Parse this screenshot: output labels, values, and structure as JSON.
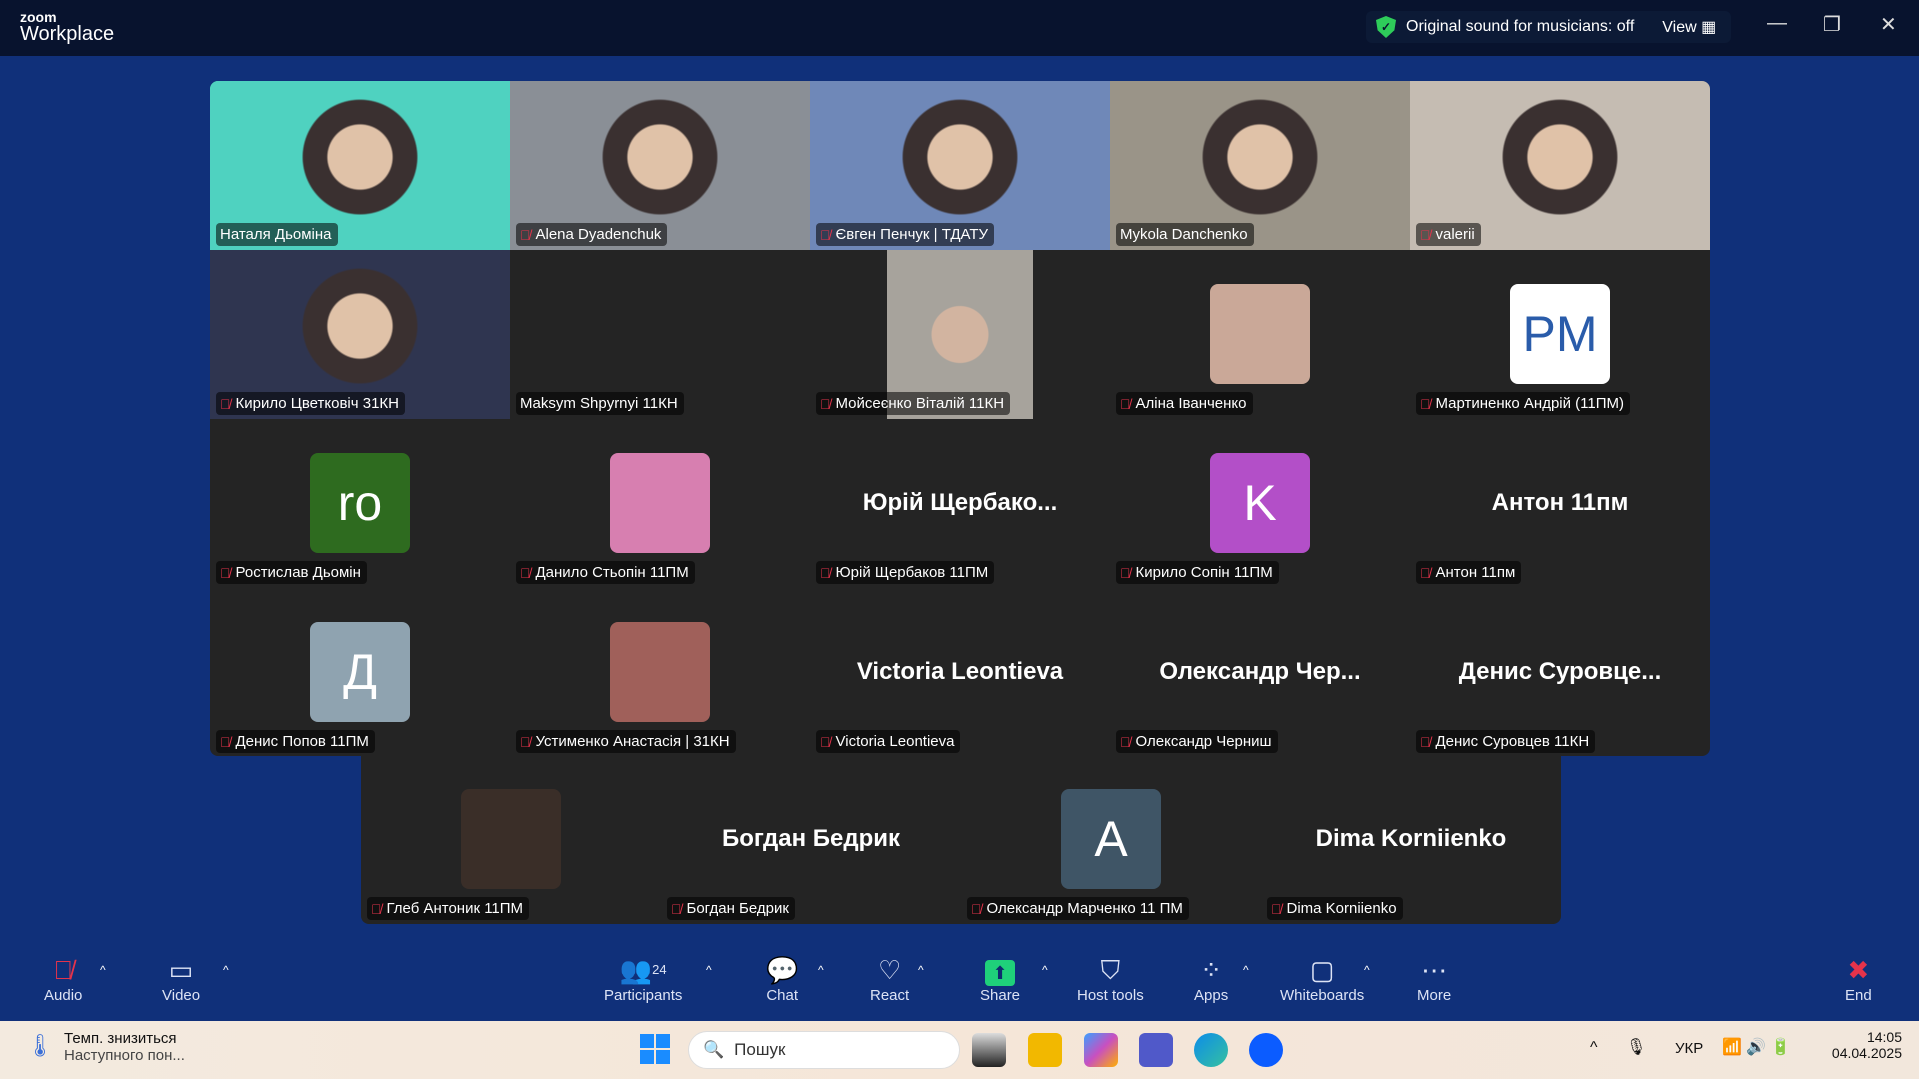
{
  "app": {
    "brand_small": "zoom",
    "brand_large": "Workplace"
  },
  "topbar": {
    "sound_status": "Original sound for musicians: off",
    "view_label": "View"
  },
  "tiles": [
    {
      "name": "Наталя Дьоміна",
      "type": "video",
      "bg": "#4fd2c0",
      "muted": false,
      "active": true
    },
    {
      "name": "Alena Dyadenchuk",
      "type": "video",
      "bg": "#8a8f96",
      "muted": true
    },
    {
      "name": "Євген Пенчук | ТДАТУ",
      "type": "video",
      "bg": "#6f88b8",
      "muted": true
    },
    {
      "name": "Mykola Danchenko",
      "type": "video",
      "bg": "#9a9488",
      "muted": false
    },
    {
      "name": "valerii",
      "type": "video",
      "bg": "#c5bcb2",
      "muted": true
    },
    {
      "name": "Кирило Цветковіч 31КН",
      "type": "video",
      "bg": "#2f3550",
      "muted": true
    },
    {
      "name": "Maksym Shpyrnyi 11КН",
      "type": "blank",
      "muted": false
    },
    {
      "name": "Мойсеєнко Віталій 11КН",
      "type": "portrait",
      "bg": "#a7a39c",
      "muted": true
    },
    {
      "name": "Аліна Іванченко",
      "type": "avatar",
      "bg": "#caa898",
      "initial": "",
      "muted": true
    },
    {
      "name": "Мартиненко Андрій (11ПМ)",
      "type": "avatar",
      "bg": "#ffffff",
      "initial": "PM",
      "fg": "#2a5caa",
      "muted": true
    },
    {
      "name": "Ростислав Дьомін",
      "type": "avatar",
      "bg": "#2e6b1f",
      "initial": "ro",
      "muted": true
    },
    {
      "name": "Данило Стьопін 11ПМ",
      "type": "avatar",
      "bg": "#d77fb0",
      "initial": "",
      "muted": true
    },
    {
      "name": "Юрій Щербаков 11ПМ",
      "type": "text",
      "big": "Юрій  Щербако...",
      "muted": true
    },
    {
      "name": "Кирило Сопін 11ПМ",
      "type": "avatar",
      "bg": "#b34fc8",
      "initial": "K",
      "muted": true
    },
    {
      "name": "Антон 11пм",
      "type": "text",
      "big": "Антон 11пм",
      "muted": true
    },
    {
      "name": "Денис Попов 11ПМ",
      "type": "avatar",
      "bg": "#8fa3b0",
      "initial": "Д",
      "muted": true
    },
    {
      "name": "Устименко Анастасія | 31КН",
      "type": "avatar",
      "bg": "#a0605a",
      "initial": "",
      "muted": true
    },
    {
      "name": "Victoria Leontieva",
      "type": "text",
      "big": "Victoria Leontieva",
      "muted": true
    },
    {
      "name": "Олександр Черниш",
      "type": "text",
      "big": "Олександр  Чер...",
      "muted": true
    },
    {
      "name": "Денис Суровцев 11КН",
      "type": "text",
      "big": "Денис  Суровце...",
      "muted": true
    }
  ],
  "tiles_row5": [
    {
      "name": "Глеб Антоник 11ПМ",
      "type": "avatar",
      "bg": "#3a2e28",
      "initial": "",
      "muted": true
    },
    {
      "name": "Богдан Бедрик",
      "type": "text",
      "big": "Богдан Бедрик",
      "muted": true
    },
    {
      "name": "Олександр Марченко 11 ПМ",
      "type": "avatar",
      "bg": "#3f5566",
      "initial": "A",
      "muted": true
    },
    {
      "name": "Dima Korniienko",
      "type": "text",
      "big": "Dima Korniienko",
      "muted": true
    }
  ],
  "toolbar": {
    "audio": "Audio",
    "video": "Video",
    "participants": "Participants",
    "participants_count": "24",
    "chat": "Chat",
    "react": "React",
    "share": "Share",
    "host_tools": "Host tools",
    "apps": "Apps",
    "whiteboards": "Whiteboards",
    "more": "More",
    "end": "End"
  },
  "taskbar": {
    "weather_title": "Темп. знизиться",
    "weather_sub": "Наступного пон...",
    "search_placeholder": "Пошук",
    "lang": "УКР",
    "time": "14:05",
    "date": "04.04.2025"
  },
  "colors": {
    "accent_share": "#1fd07a",
    "active_speaker": "#3ee08e",
    "end": "#e5334b"
  }
}
